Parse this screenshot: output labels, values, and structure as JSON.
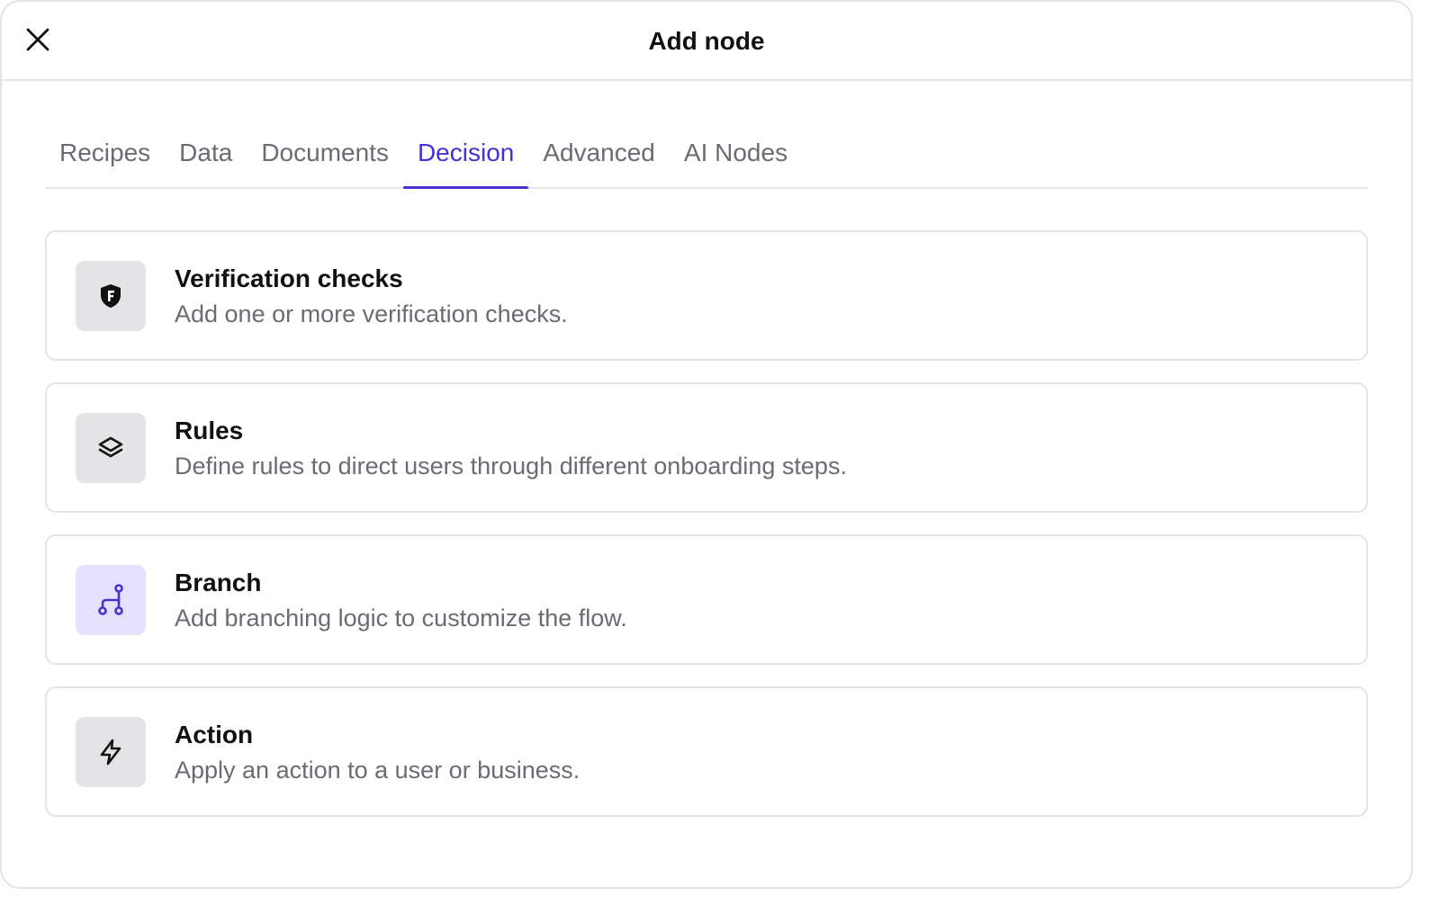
{
  "header": {
    "title": "Add node"
  },
  "tabs": [
    {
      "label": "Recipes"
    },
    {
      "label": "Data"
    },
    {
      "label": "Documents"
    },
    {
      "label": "Decision"
    },
    {
      "label": "Advanced"
    },
    {
      "label": "AI Nodes"
    }
  ],
  "active_tab": "Decision",
  "cards": [
    {
      "title": "Verification checks",
      "description": "Add one or more verification checks.",
      "icon": "shield-f-icon"
    },
    {
      "title": "Rules",
      "description": "Define rules to direct users through different onboarding steps.",
      "icon": "layers-icon"
    },
    {
      "title": "Branch",
      "description": "Add branching logic to customize the flow.",
      "icon": "branch-icon"
    },
    {
      "title": "Action",
      "description": "Apply an action to a user or business.",
      "icon": "lightning-icon"
    }
  ],
  "colors": {
    "accent": "#4a2fd0",
    "icon_bg": "#e4e4e6",
    "icon_bg_highlight": "#e6e0ff"
  }
}
